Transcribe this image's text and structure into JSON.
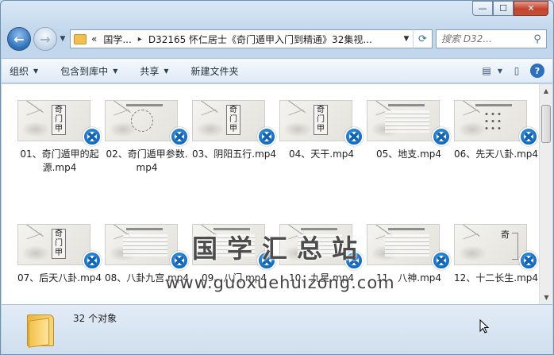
{
  "window": {
    "minimize_glyph": "—",
    "maximize_glyph": "☐",
    "close_glyph": "✕"
  },
  "nav": {
    "back_glyph": "←",
    "forward_glyph": "→",
    "breadcrumb_overflow": "«",
    "breadcrumb_root": "国学...",
    "breadcrumb_sep": "▸",
    "breadcrumb_current": "D32165 怀仁居士《奇门遁甲入门到精通》32集视...",
    "search_placeholder": "搜索 D32...",
    "refresh_glyph": "⟳",
    "search_icon": "magnifier-icon"
  },
  "toolbar": {
    "organize": "组织",
    "include_in_library": "包含到库中",
    "share": "共享",
    "new_folder": "新建文件夹"
  },
  "files": [
    {
      "label": "01、奇门遁甲的起源.mp4",
      "thumb": "title"
    },
    {
      "label": "02、奇门遁甲参数.mp4",
      "thumb": "circle"
    },
    {
      "label": "03、阴阳五行.mp4",
      "thumb": "title"
    },
    {
      "label": "04、天干.mp4",
      "thumb": "title"
    },
    {
      "label": "05、地支.mp4",
      "thumb": "lines"
    },
    {
      "label": "06、先天八卦.mp4",
      "thumb": "dots"
    },
    {
      "label": "07、后天八卦.mp4",
      "thumb": "title"
    },
    {
      "label": "08、八卦九宫.mp4",
      "thumb": "lines"
    },
    {
      "label": "09、八门.mp4",
      "thumb": "lines"
    },
    {
      "label": "10、九星.mp4",
      "thumb": "lines"
    },
    {
      "label": "11、八神.mp4",
      "thumb": "lines"
    },
    {
      "label": "12、十二长生.mp4",
      "thumb": "bracket"
    }
  ],
  "thumb_text": {
    "title_chars": "奇\n门\n甲",
    "top_char": "奇"
  },
  "watermark": {
    "title": "国学汇总站",
    "url": "www.guoxuehuizong.com"
  },
  "status": {
    "count": "32 个对象"
  },
  "colors": {
    "accent": "#0d63b8",
    "window_frame": "#c2d7ec",
    "close_button": "#c4412b",
    "folder": "#f2c04f"
  }
}
